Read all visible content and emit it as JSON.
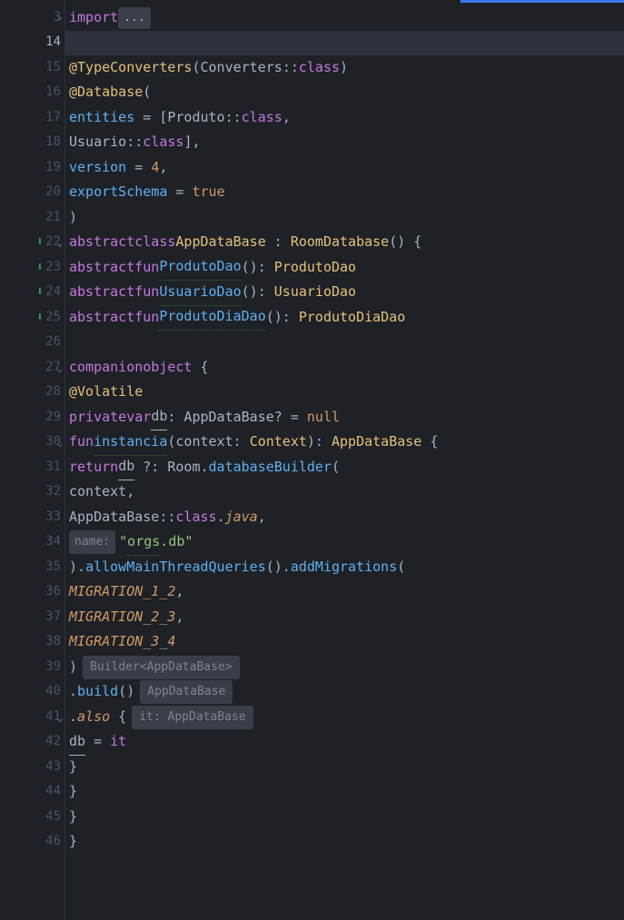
{
  "gutter": {
    "lines": [
      3,
      14,
      15,
      16,
      17,
      18,
      19,
      20,
      21,
      22,
      23,
      24,
      25,
      26,
      27,
      28,
      29,
      30,
      31,
      32,
      33,
      34,
      35,
      36,
      37,
      38,
      39,
      40,
      41,
      42,
      43,
      44,
      45,
      46
    ],
    "active_line": 14,
    "foldable_lines": [
      3,
      22,
      27,
      30,
      41
    ],
    "override_markers": [
      23,
      24,
      25
    ]
  },
  "code": {
    "line3_import": "import",
    "line3_dots": "...",
    "line15_ann": "@TypeConverters",
    "line15_paren1": "(",
    "line15_conv": "Converters",
    "line15_cc": "::",
    "line15_class": "class",
    "line15_paren2": ")",
    "line16_ann": "@Database",
    "line16_paren": "(",
    "line17_entities": "entities",
    "line17_eq": " = [",
    "line17_produto": "Produto",
    "line17_cc": "::",
    "line17_class": "class",
    "line17_comma": ",",
    "line18_usuario": "Usuario",
    "line18_cc": "::",
    "line18_class": "class",
    "line18_close": "],",
    "line19_version": "version",
    "line19_eq": " = ",
    "line19_num": "4",
    "line19_comma": ",",
    "line20_export": "exportSchema",
    "line20_eq": " = ",
    "line20_true": "true",
    "line21_paren": ")",
    "line22_abstract": "abstract",
    "line22_class": "class",
    "line22_name": "AppDataBase",
    "line22_colon": " : ",
    "line22_room": "RoomDatabase",
    "line22_parens": "() {",
    "line23_abstract": "abstract",
    "line23_fun": "fun",
    "line23_name": "ProdutoDao",
    "line23_sig": "(): ",
    "line23_ret": "ProdutoDao",
    "line24_abstract": "abstract",
    "line24_fun": "fun",
    "line24_name": "UsuarioDao",
    "line24_sig": "(): ",
    "line24_ret": "UsuarioDao",
    "line25_abstract": "abstract",
    "line25_fun": "fun",
    "line25_name": "ProdutoDiaDao",
    "line25_sig": "(): ",
    "line25_ret": "ProdutoDiaDao",
    "line27_companion": "companion",
    "line27_object": "object",
    "line27_brace": " {",
    "line28_volatile": "@Volatile",
    "line29_private": "private",
    "line29_var": "var",
    "line29_db": "db",
    "line29_type": ": AppDataBase? = ",
    "line29_null": "null",
    "line30_fun": "fun",
    "line30_name": "instancia",
    "line30_sig1": "(context: ",
    "line30_ctx": "Context",
    "line30_sig2": "): ",
    "line30_ret": "AppDataBase",
    "line30_brace": " {",
    "line31_return": "return",
    "line31_db": "db",
    "line31_elvis": " ?: ",
    "line31_room": "Room",
    "line31_dot": ".",
    "line31_builder": "databaseBuilder",
    "line31_paren": "(",
    "line32_context": "context,",
    "line33_adb": "AppDataBase",
    "line33_cc": "::",
    "line33_class": "class",
    "line33_dot": ".",
    "line33_java": "java",
    "line33_comma": ",",
    "line34_hint": "name:",
    "line34_q1": "\"",
    "line34_orgs": "orgs",
    "line34_db": ".db",
    "line34_q2": "\"",
    "line35_close": ").",
    "line35_allow": "allowMainThreadQueries",
    "line35_parens": "().",
    "line35_add": "addMigrations",
    "line35_paren": "(",
    "line36_mig": "MIGRATION_1_2",
    "line36_comma": ",",
    "line37_mig": "MIGRATION_2_3",
    "line37_comma": ",",
    "line38_mig": "MIGRATION_3_4",
    "line39_close": ")",
    "line39_hint": "Builder<AppDataBase>",
    "line40_dot": ".",
    "line40_build": "build",
    "line40_parens": "()",
    "line40_hint": "AppDataBase",
    "line41_dot": ".",
    "line41_also": "also",
    "line41_brace": " {",
    "line41_hint": "it: AppDataBase",
    "line42_db": "db",
    "line42_eq": " = ",
    "line42_it": "it",
    "line43_brace": "}",
    "line44_brace": "}",
    "line45_brace": "}",
    "line46_brace": "}"
  }
}
